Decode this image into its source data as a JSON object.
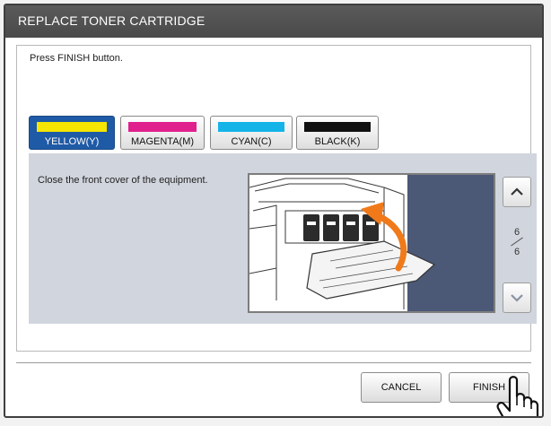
{
  "window": {
    "title": "REPLACE TONER CARTRIDGE"
  },
  "instruction": {
    "message": "Press FINISH button."
  },
  "color_tabs": [
    {
      "label": "YELLOW(Y)",
      "color": "#f5e500",
      "selected": true
    },
    {
      "label": "MAGENTA(M)",
      "color": "#e0208c",
      "selected": false
    },
    {
      "label": "CYAN(C)",
      "color": "#14b4e8",
      "selected": false
    },
    {
      "label": "BLACK(K)",
      "color": "#111111",
      "selected": false
    }
  ],
  "step": {
    "text": "Close the front cover of the equipment."
  },
  "pagination": {
    "current": "6",
    "total": "6",
    "up_icon": "chevron-up-icon",
    "down_icon": "chevron-down-icon"
  },
  "buttons": {
    "cancel": "CANCEL",
    "finish": "FINISH"
  },
  "colors": {
    "accent": "#1f5aa6",
    "titlebar": "#4f4f4f",
    "panel": "#d1d5dd",
    "arrow": "#f07a1a"
  }
}
